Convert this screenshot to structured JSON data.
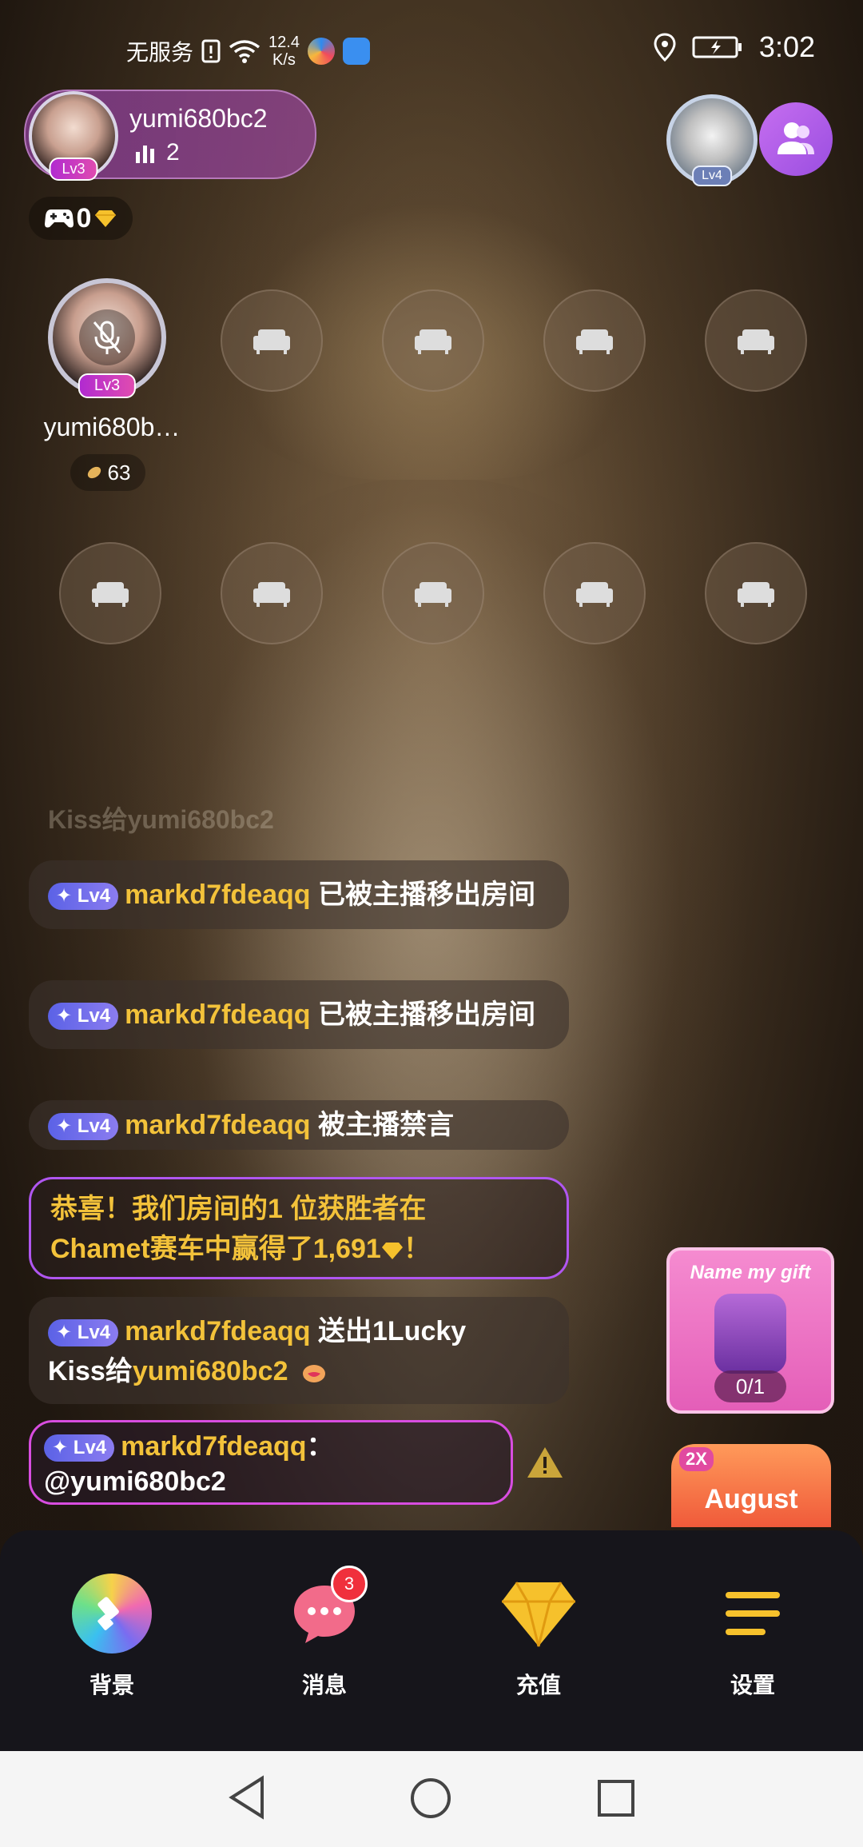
{
  "status_bar": {
    "carrier": "无服务",
    "speed_value": "12.4",
    "speed_unit": "K/s",
    "time": "3:02"
  },
  "host": {
    "name": "yumi680bc2",
    "level": "Lv3",
    "count": "2"
  },
  "game_pill": {
    "value": "0"
  },
  "viewer": {
    "level": "Lv4"
  },
  "seat_main": {
    "name": "yumi680b…",
    "level": "Lv3",
    "score": "63"
  },
  "chat": {
    "faded": "Kiss给yumi680bc2",
    "messages": [
      {
        "level": "Lv4",
        "user": "markd7fdeaqq",
        "text": "已被主播移出房间"
      },
      {
        "level": "Lv4",
        "user": "markd7fdeaqq",
        "text": "已被主播移出房间"
      },
      {
        "level": "Lv4",
        "user": "markd7fdeaqq",
        "text": "被主播禁言"
      }
    ],
    "system": {
      "line1": "恭喜！我们房间的1 位获胜者在",
      "line2": "Chamet赛车中赢得了1,691",
      "suffix": "！"
    },
    "gift_msg": {
      "level": "Lv4",
      "user": "markd7fdeaqq",
      "text": "送出1Lucky",
      "text2": "Kiss给",
      "target": "yumi680bc2"
    },
    "mention": {
      "level": "Lv4",
      "user": "markd7fdeaqq",
      "colon": "：",
      "text": "@yumi680bc2"
    }
  },
  "gift_card": {
    "title": "Name my gift",
    "progress": "0/1"
  },
  "event_banner": {
    "multiplier": "2X",
    "text": "August"
  },
  "bottom_tabs": [
    {
      "label": "背景",
      "icon": "brush-icon"
    },
    {
      "label": "消息",
      "icon": "message-icon",
      "badge": "3"
    },
    {
      "label": "充值",
      "icon": "diamond-icon"
    },
    {
      "label": "设置",
      "icon": "menu-icon"
    }
  ]
}
